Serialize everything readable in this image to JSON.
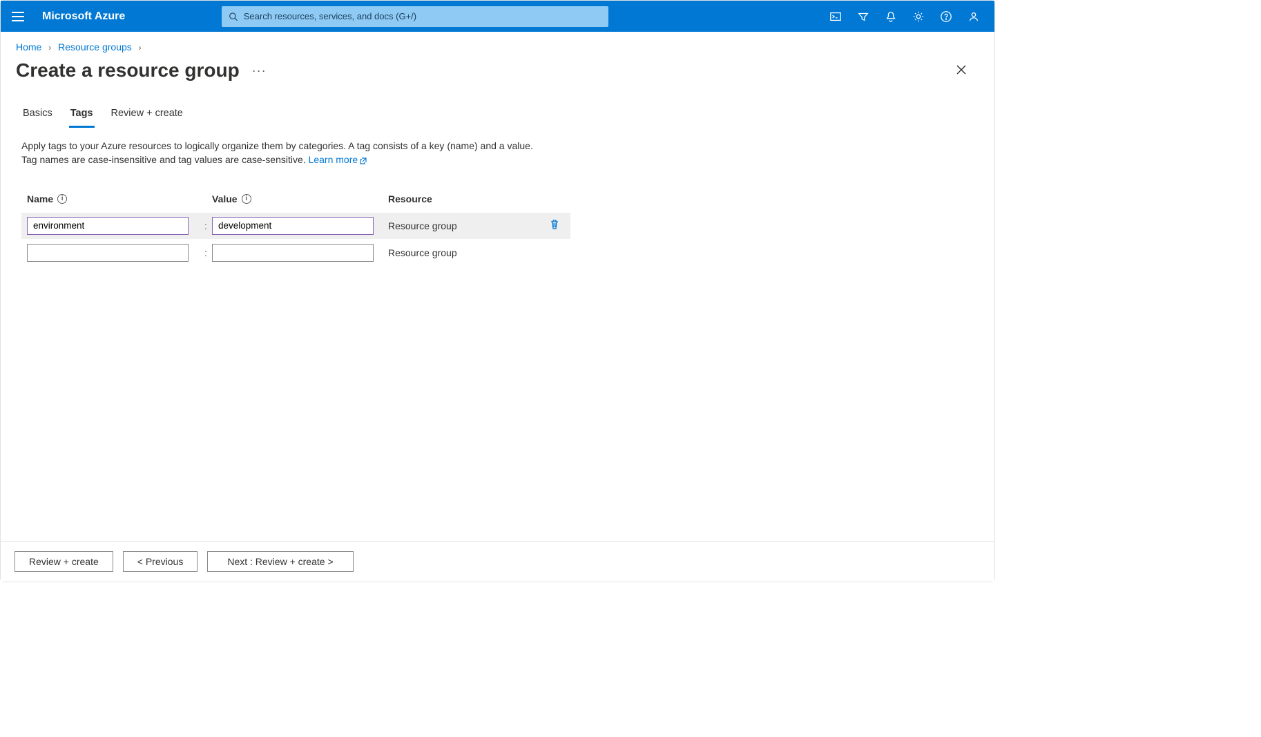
{
  "brand": "Microsoft Azure",
  "search_placeholder": "Search resources, services, and docs (G+/)",
  "breadcrumb": {
    "home": "Home",
    "rg": "Resource groups"
  },
  "page_title": "Create a resource group",
  "tabs": {
    "basics": "Basics",
    "tags": "Tags",
    "review": "Review + create"
  },
  "description": {
    "line1": "Apply tags to your Azure resources to logically organize them by categories. A tag consists of a key (name) and a value.",
    "line2_prefix": "Tag names are case-insensitive and tag values are case-sensitive. ",
    "learn_more": "Learn more"
  },
  "columns": {
    "name": "Name",
    "value": "Value",
    "resource": "Resource"
  },
  "rows": [
    {
      "name": "environment",
      "value": "development",
      "resource": "Resource group"
    },
    {
      "name": "",
      "value": "",
      "resource": "Resource group"
    }
  ],
  "footer": {
    "review": "Review + create",
    "prev": "< Previous",
    "next": "Next : Review + create >"
  }
}
